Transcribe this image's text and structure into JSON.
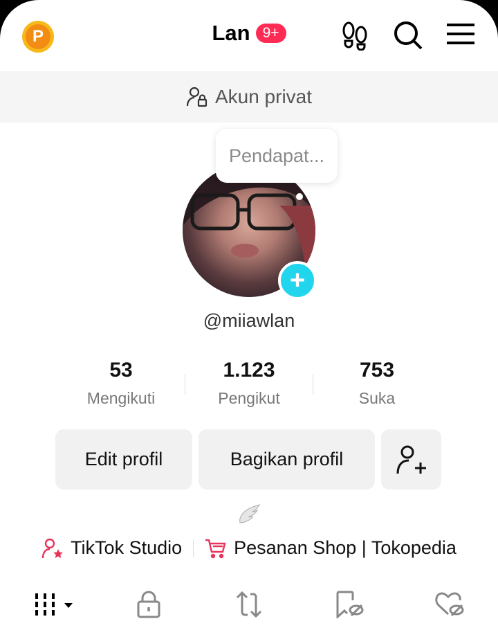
{
  "header": {
    "coin_label": "P",
    "title": "Lan",
    "badge": "9+"
  },
  "private_bar": {
    "label": "Akun privat"
  },
  "note_bubble": {
    "text": "Pendapat..."
  },
  "profile": {
    "username": "@miiawlan"
  },
  "stats": [
    {
      "value": "53",
      "label": "Mengikuti"
    },
    {
      "value": "1.123",
      "label": "Pengikut"
    },
    {
      "value": "753",
      "label": "Suka"
    }
  ],
  "buttons": {
    "edit": "Edit profil",
    "share": "Bagikan profil"
  },
  "links": {
    "studio": "TikTok Studio",
    "shop": "Pesanan Shop | Tokopedia"
  },
  "colors": {
    "accent": "#fe2c55",
    "plus": "#20d5ec"
  }
}
